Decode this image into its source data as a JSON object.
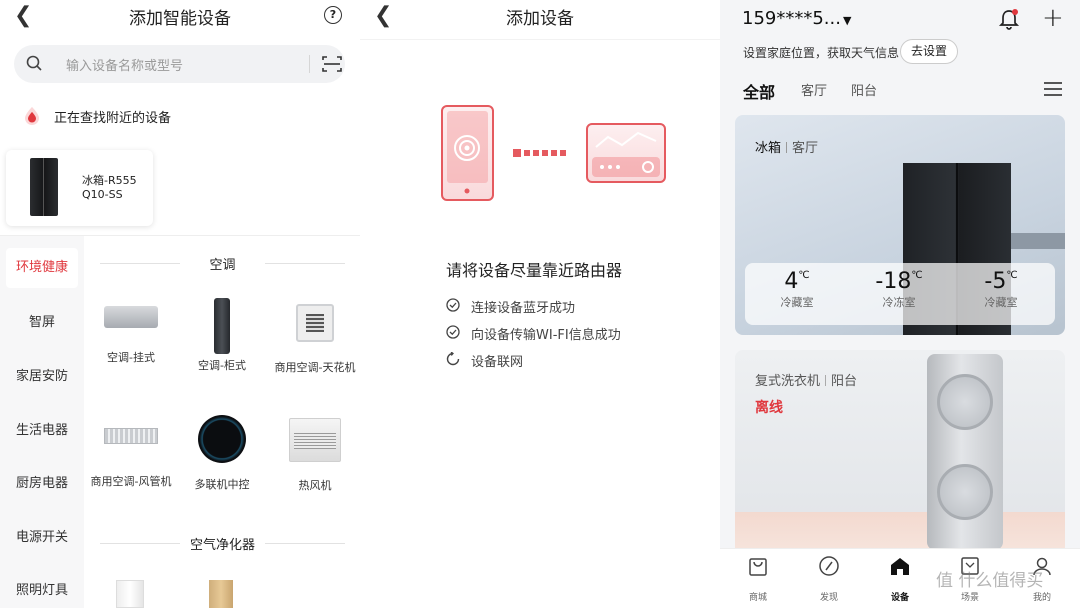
{
  "add_smart": {
    "title": "添加智能设备",
    "search_placeholder": "输入设备名称或型号",
    "nearby_text": "正在查找附近的设备",
    "found_device": {
      "name_line1": "冰箱-R555",
      "name_line2": "Q10-SS"
    },
    "categories": [
      "环境健康",
      "智屏",
      "家居安防",
      "生活电器",
      "厨房电器",
      "电源开关",
      "照明灯具"
    ],
    "active_category": "环境健康",
    "section_ac": "空调",
    "ac_items": [
      {
        "label": "空调-挂式"
      },
      {
        "label": "空调-柜式"
      },
      {
        "label": "商用空调-天花机"
      },
      {
        "label": "商用空调-风管机"
      },
      {
        "label": "多联机中控"
      },
      {
        "label": "热风机"
      }
    ],
    "section_purifier": "空气净化器"
  },
  "add_device": {
    "title": "添加设备",
    "instruction": "请将设备尽量靠近路由器",
    "steps": [
      {
        "text": "连接设备蓝牙成功",
        "state": "done"
      },
      {
        "text": "向设备传输WI-FI信息成功",
        "state": "done"
      },
      {
        "text": "设备联网",
        "state": "loading"
      }
    ],
    "accent": "#e55a5f"
  },
  "home": {
    "account": "159****5...",
    "location_prompt": "设置家庭位置，获取天气信息",
    "location_button": "去设置",
    "room_tabs": [
      "全部",
      "客厅",
      "阳台"
    ],
    "active_room": "全部",
    "fridge_card": {
      "name": "冰箱",
      "room": "客厅",
      "temps": [
        {
          "value": "4",
          "unit": "℃",
          "label": "冷藏室"
        },
        {
          "value": "-18",
          "unit": "℃",
          "label": "冷冻室"
        },
        {
          "value": "-5",
          "unit": "℃",
          "label": "冷藏室"
        }
      ]
    },
    "washer_card": {
      "name": "复式洗衣机",
      "room": "阳台",
      "status": "离线"
    },
    "tabs": [
      {
        "label": "商城",
        "icon": "shop-bag-icon"
      },
      {
        "label": "发现",
        "icon": "compass-icon"
      },
      {
        "label": "设备",
        "icon": "home-icon"
      },
      {
        "label": "场景",
        "icon": "scene-icon"
      },
      {
        "label": "我的",
        "icon": "person-icon"
      }
    ],
    "active_tab": "设备",
    "watermark": "值 什么值得买",
    "status_color": "#e0383e"
  }
}
